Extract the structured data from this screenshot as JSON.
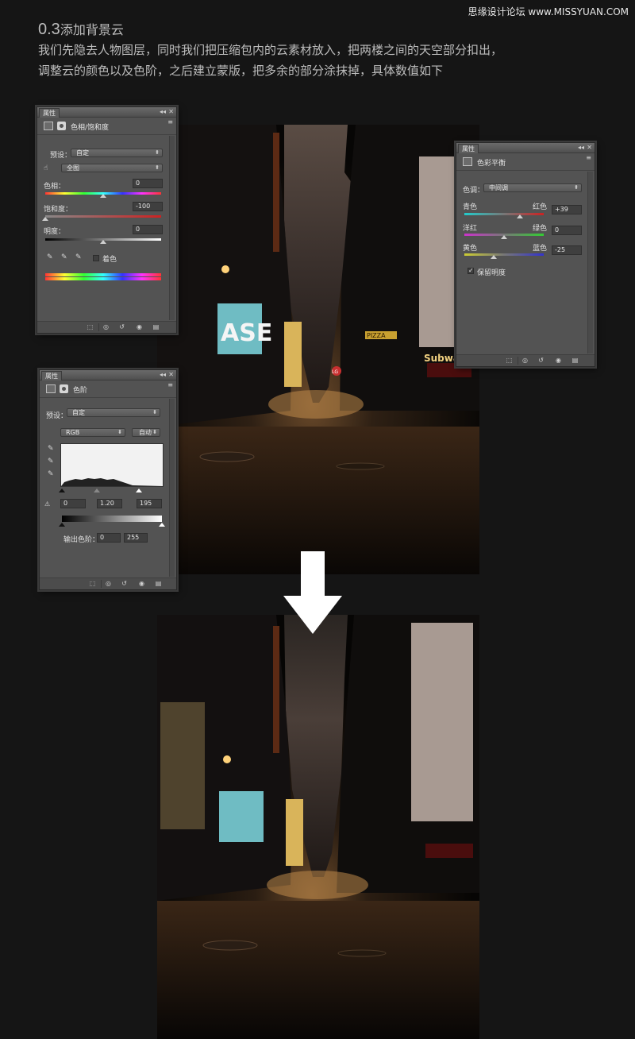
{
  "watermark": "思缘设计论坛 www.MISSYUAN.COM",
  "heading": {
    "number": "0.3",
    "title": "添加背景云"
  },
  "intro": {
    "line1": "我们先隐去人物图层，同时我们把压缩包内的云素材放入，把两楼之间的天空部分扣出，",
    "line2": "调整云的颜色以及色阶，之后建立蒙版，把多余的部分涂抹掉，具体数值如下"
  },
  "photo_signs": {
    "billboard": "ASE",
    "subway": "Subway",
    "pizza": "PIZZA",
    "lg": "LG"
  },
  "hue_panel": {
    "tab": "属性",
    "header": "色相/饱和度",
    "preset_label": "预设：",
    "preset_value": "自定",
    "channel_value": "全图",
    "hue_label": "色相：",
    "hue_value": "0",
    "saturation_label": "饱和度：",
    "saturation_value": "-100",
    "lightness_label": "明度：",
    "lightness_value": "0",
    "colorize_label": "着色"
  },
  "color_balance_panel": {
    "tab": "属性",
    "header": "色彩平衡",
    "tone_label": "色调：",
    "tone_value": "中间调",
    "cyan": "青色",
    "red": "红色",
    "cr_value": "+39",
    "magenta": "洋红",
    "green": "绿色",
    "mg_value": "0",
    "yellow": "黄色",
    "blue": "蓝色",
    "yb_value": "-25",
    "preserve_label": "保留明度"
  },
  "levels_panel": {
    "tab": "属性",
    "header": "色阶",
    "preset_label": "预设：",
    "preset_value": "自定",
    "channel_value": "RGB",
    "auto_label": "自动",
    "input_black": "0",
    "input_gamma": "1.20",
    "input_white": "195",
    "output_label": "输出色阶：",
    "output_black": "0",
    "output_white": "255"
  },
  "icons": [
    "panel-tab-collapse-icon",
    "panel-close-icon",
    "panel-menu-icon",
    "clip-layer-icon",
    "view-previous-icon",
    "reset-icon",
    "visibility-icon",
    "delete-icon",
    "eyedropper-icon",
    "hand-adjust-icon",
    "checkbox-icon",
    "down-arrow-icon"
  ]
}
